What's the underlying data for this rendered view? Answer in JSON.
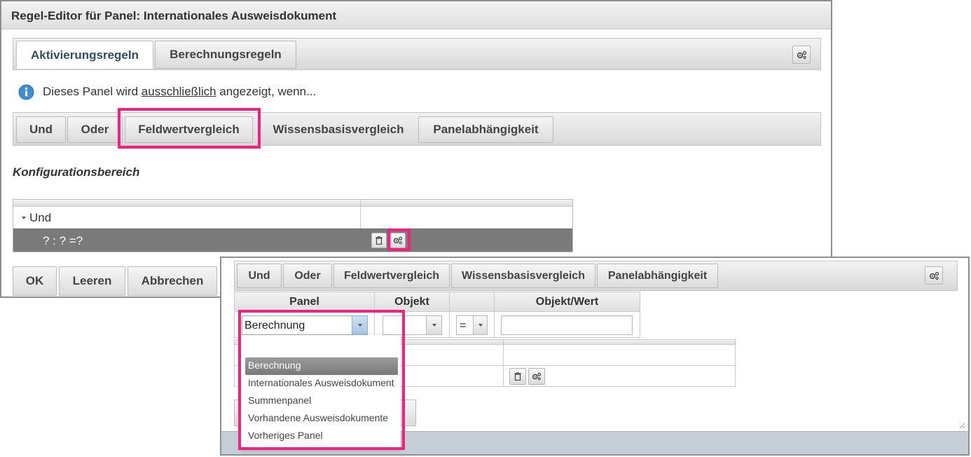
{
  "editor": {
    "title": "Regel-Editor für Panel: Internationales Ausweisdokument",
    "tabs": [
      "Aktivierungsregeln",
      "Berechnungsregeln"
    ],
    "info_prefix": "Dieses Panel wird ",
    "info_link": "ausschließlich",
    "info_suffix": " angezeigt, wenn...",
    "toolbar": [
      "Und",
      "Oder",
      "Feldwertvergleich",
      "Wissensbasisvergleich",
      "Panelabhängigkeit"
    ],
    "section_title": "Konfigurationsbereich",
    "tree_root": "Und",
    "tree_condition": "? : ? =?",
    "footer": [
      "OK",
      "Leeren",
      "Abbrechen"
    ]
  },
  "popup": {
    "toolbar": [
      "Und",
      "Oder",
      "Feldwertvergleich",
      "Wissensbasisvergleich",
      "Panelabhängigkeit"
    ],
    "columns": [
      "Panel",
      "Objekt",
      "",
      "Objekt/Wert"
    ],
    "panel_value": "Berechnung",
    "operator_value": "=",
    "dropdown_options": [
      "Berechnung",
      "Internationales Ausweisdokument",
      "Summenpanel",
      "Vorhandene Ausweisdokumente",
      "Vorheriges Panel"
    ],
    "selected_option_index": 0
  },
  "colors": {
    "highlight": "#f0247e",
    "selected_row": "#7a7a7a",
    "info_icon": "#3b8fd6"
  }
}
